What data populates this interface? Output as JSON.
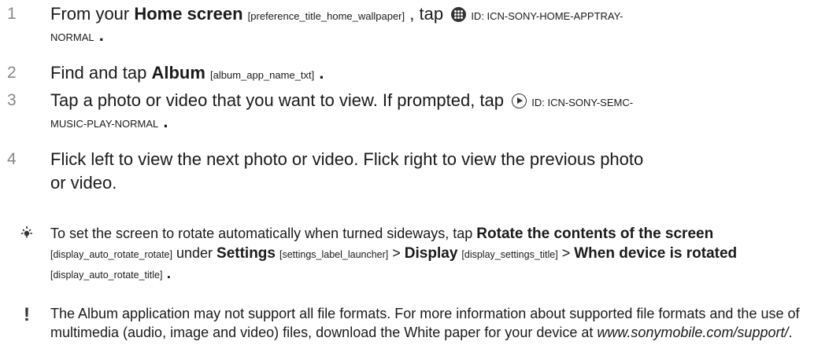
{
  "steps": [
    {
      "number": "1",
      "text_before": "From your ",
      "bold": "Home screen",
      "tag": "[preference_title_home_wallpaper]",
      "text_after": " , tap ",
      "icon": "app-tray-icon",
      "icon_id_line1": "ID: ICN-SONY-HOME-APPTRAY-",
      "icon_id_line2": "NORMAL",
      "end": " ."
    },
    {
      "number": "2",
      "text_before": "Find and tap ",
      "bold": "Album",
      "tag": "[album_app_name_txt]",
      "end": " ."
    },
    {
      "number": "3",
      "text_before": "Tap a photo or video that you want to view. If prompted, tap ",
      "icon": "play-icon",
      "icon_id_line1": "ID: ICN-SONY-SEMC-",
      "icon_id_line2": "MUSIC-PLAY-NORMAL",
      "end": " ."
    },
    {
      "number": "4",
      "line1": "Flick left to view the next photo or video. Flick right to view the previous photo",
      "line2": "or video."
    }
  ],
  "tip": {
    "icon": "lightbulb-icon",
    "t1": "To set the screen to rotate automatically when turned sideways, tap ",
    "b1": "Rotate the contents of the screen",
    "tag1": "[display_auto_rotate_rotate]",
    "t2": " under ",
    "b2": "Settings",
    "tag2": "[settings_label_launcher]",
    "t3": " > ",
    "b3": "Display",
    "tag3": "[display_settings_title]",
    "t4": " > ",
    "b4": "When device is rotated",
    "tag4": "[display_auto_rotate_title]",
    "end": " ."
  },
  "note": {
    "icon": "exclamation-icon",
    "text": "The Album application may not support all file formats. For more information about supported file formats and the use of multimedia (audio, image and video) files, download the White paper for your device at ",
    "url": "www.sonymobile.com/support/",
    "end": "."
  }
}
